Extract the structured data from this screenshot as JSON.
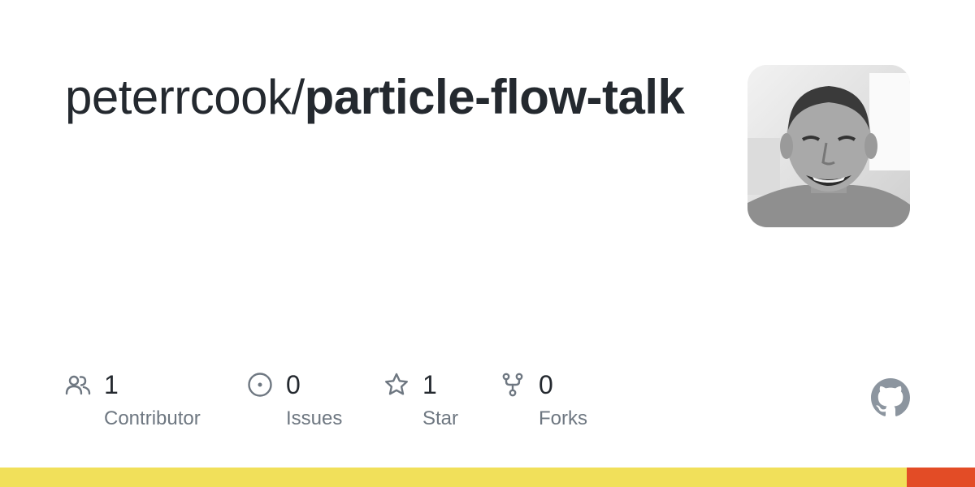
{
  "repo": {
    "owner": "peterrcook/",
    "name": "particle-flow-talk"
  },
  "stats": [
    {
      "value": "1",
      "label": "Contributor",
      "icon": "people-icon"
    },
    {
      "value": "0",
      "label": "Issues",
      "icon": "issue-circle-icon"
    },
    {
      "value": "1",
      "label": "Star",
      "icon": "star-icon"
    },
    {
      "value": "0",
      "label": "Forks",
      "icon": "fork-icon"
    }
  ],
  "colors": {
    "text_primary": "#24292f",
    "text_secondary": "#6e7781",
    "icon": "#6e7781",
    "languages": [
      "#f1e05a",
      "#e34c26"
    ]
  },
  "languages": [
    {
      "color": "#f1e05a",
      "share": 0.93
    },
    {
      "color": "#e34c26",
      "share": 0.07
    }
  ]
}
